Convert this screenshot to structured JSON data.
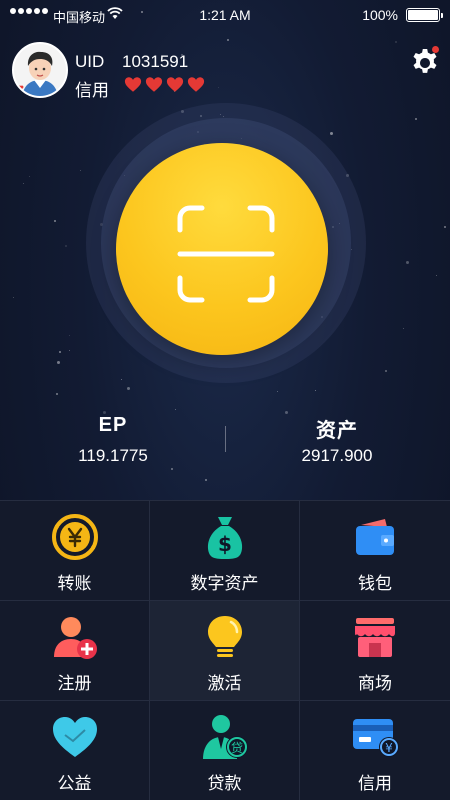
{
  "status_bar": {
    "carrier": "中国移动",
    "time": "1:21 AM",
    "battery_percent": "100%",
    "signal_dots": 5,
    "battery_level": 1.0
  },
  "profile": {
    "uid_label": "UID",
    "uid_value": "1031591",
    "credit_label": "信用",
    "hearts": 4,
    "heart_color": "#e53935"
  },
  "scan": {
    "icon": "scan-icon",
    "button_color": "#fcc61e"
  },
  "stats": {
    "ep_title": "EP",
    "ep_value": "119.1775",
    "assets_title": "资产",
    "assets_value": "2917.900"
  },
  "grid": {
    "items": [
      {
        "label": "转账",
        "icon": "transfer-icon"
      },
      {
        "label": "数字资产",
        "icon": "money-bag-icon"
      },
      {
        "label": "钱包",
        "icon": "wallet-icon"
      },
      {
        "label": "注册",
        "icon": "add-user-icon"
      },
      {
        "label": "激活",
        "icon": "lightbulb-icon"
      },
      {
        "label": "商场",
        "icon": "store-icon"
      },
      {
        "label": "公益",
        "icon": "charity-heart-icon"
      },
      {
        "label": "贷款",
        "icon": "loan-icon",
        "badge": "贷"
      },
      {
        "label": "信用",
        "icon": "credit-card-icon",
        "badge": "¥"
      }
    ]
  },
  "colors": {
    "background": "#0f1628",
    "grid_background": "#141a2b",
    "accent_yellow": "#fcc61e",
    "notification_dot": "#e53935"
  }
}
